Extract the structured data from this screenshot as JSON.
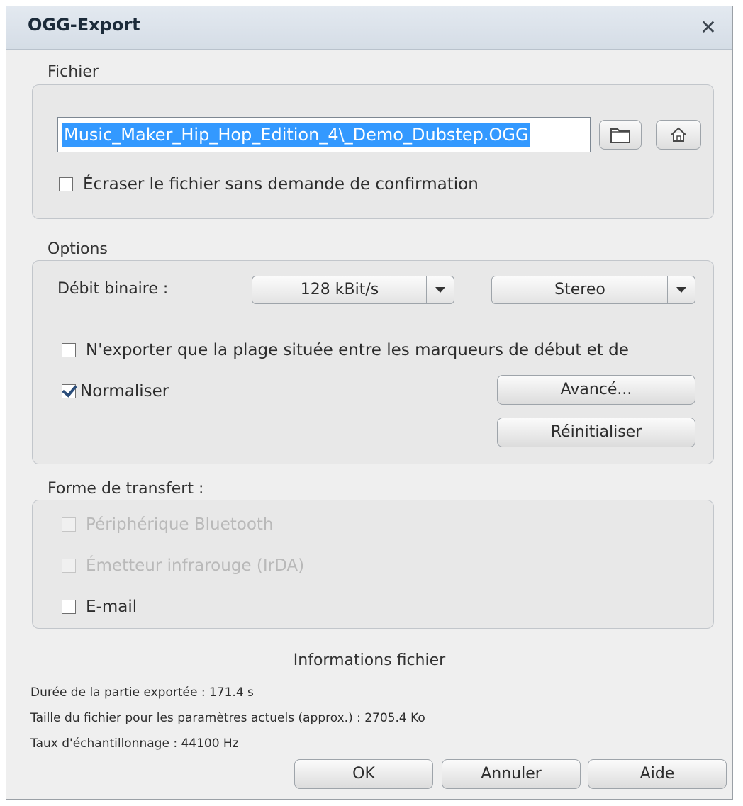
{
  "window": {
    "title": "OGG-Export",
    "close_label": "✕"
  },
  "file_section": {
    "label": "Fichier",
    "path_value": "Music_Maker_Hip_Hop_Edition_4\\_Demo_Dubstep.OGG",
    "browse_icon": "folder-icon",
    "home_icon": "home-icon",
    "overwrite_label": "Écraser le fichier sans demande de confirmation",
    "overwrite_checked": false
  },
  "options_section": {
    "label": "Options",
    "bitrate_label": "Débit binaire :",
    "bitrate_value": "128 kBit/s",
    "channel_value": "Stereo",
    "range_only_label": "N'exporter que la plage située entre les marqueurs de début et de",
    "range_only_checked": false,
    "normalize_label": "Normaliser",
    "normalize_checked": true,
    "advanced_label": "Avancé...",
    "reset_label": "Réinitialiser"
  },
  "transfer_section": {
    "label": "Forme de transfert :",
    "items": [
      {
        "label": "Périphérique Bluetooth",
        "checked": false,
        "enabled": false
      },
      {
        "label": "Émetteur infrarouge (IrDA)",
        "checked": false,
        "enabled": false
      },
      {
        "label": "E-mail",
        "checked": false,
        "enabled": true
      }
    ]
  },
  "file_info": {
    "title": "Informations fichier",
    "duration": "Durée de la partie exportée : 171.4 s",
    "size": "Taille du fichier pour les paramètres actuels (approx.) : 2705.4 Ko",
    "sample_rate": "Taux d'échantillonnage : 44100 Hz"
  },
  "footer": {
    "ok_label": "OK",
    "cancel_label": "Annuler",
    "help_label": "Aide"
  }
}
